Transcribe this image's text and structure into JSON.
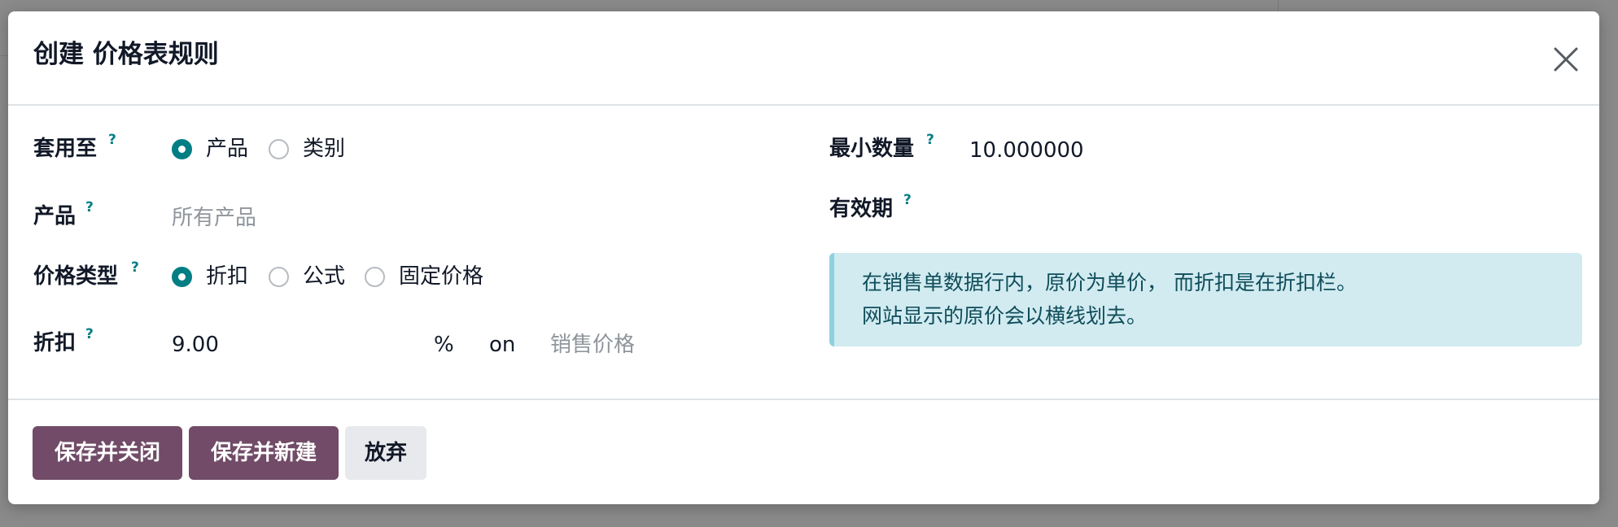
{
  "dialog": {
    "title": "创建 价格表规则"
  },
  "form": {
    "help_marker": "?",
    "apply_on": {
      "label": "套用至",
      "options": [
        {
          "label": "产品",
          "checked": true
        },
        {
          "label": "类别",
          "checked": false
        }
      ]
    },
    "product": {
      "label": "产品",
      "placeholder": "所有产品"
    },
    "price_type": {
      "label": "价格类型",
      "options": [
        {
          "label": "折扣",
          "checked": true
        },
        {
          "label": "公式",
          "checked": false
        },
        {
          "label": "固定价格",
          "checked": false
        }
      ]
    },
    "discount": {
      "label": "折扣",
      "value": "9.00",
      "unit": "%",
      "on_text": "on",
      "base_placeholder": "销售价格"
    },
    "min_quantity": {
      "label": "最小数量",
      "value": "10.000000"
    },
    "validity": {
      "label": "有效期"
    },
    "info": {
      "line1": "在销售单数据行内，原价为单价， 而折扣是在折扣栏。",
      "line2": "网站显示的原价会以横线划去。"
    }
  },
  "footer": {
    "save_close": "保存并关闭",
    "save_new": "保存并新建",
    "discard": "放弃"
  },
  "colors": {
    "primary": "#714b67",
    "accent": "#017e84",
    "info_bg": "#d1ebf1"
  }
}
